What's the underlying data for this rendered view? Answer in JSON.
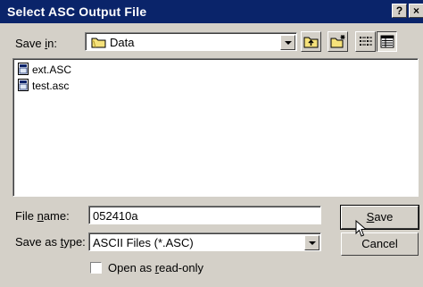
{
  "window": {
    "title": "Select ASC Output File",
    "help_button": "?",
    "close_button": "×"
  },
  "toolbar": {
    "save_in_label": "Save in:",
    "save_in_value": "Data"
  },
  "file_list": {
    "items": [
      {
        "name": "ext.ASC"
      },
      {
        "name": "test.asc"
      }
    ]
  },
  "form": {
    "file_name_label": "File name:",
    "file_name_value": "052410a",
    "save_type_label": "Save as type:",
    "save_type_value": "ASCII Files (*.ASC)",
    "readonly_label": "Open as read-only",
    "readonly_checked": false
  },
  "buttons": {
    "save": "Save",
    "cancel": "Cancel"
  },
  "colors": {
    "titlebar": "#0a246a",
    "face": "#d4d0c8"
  }
}
